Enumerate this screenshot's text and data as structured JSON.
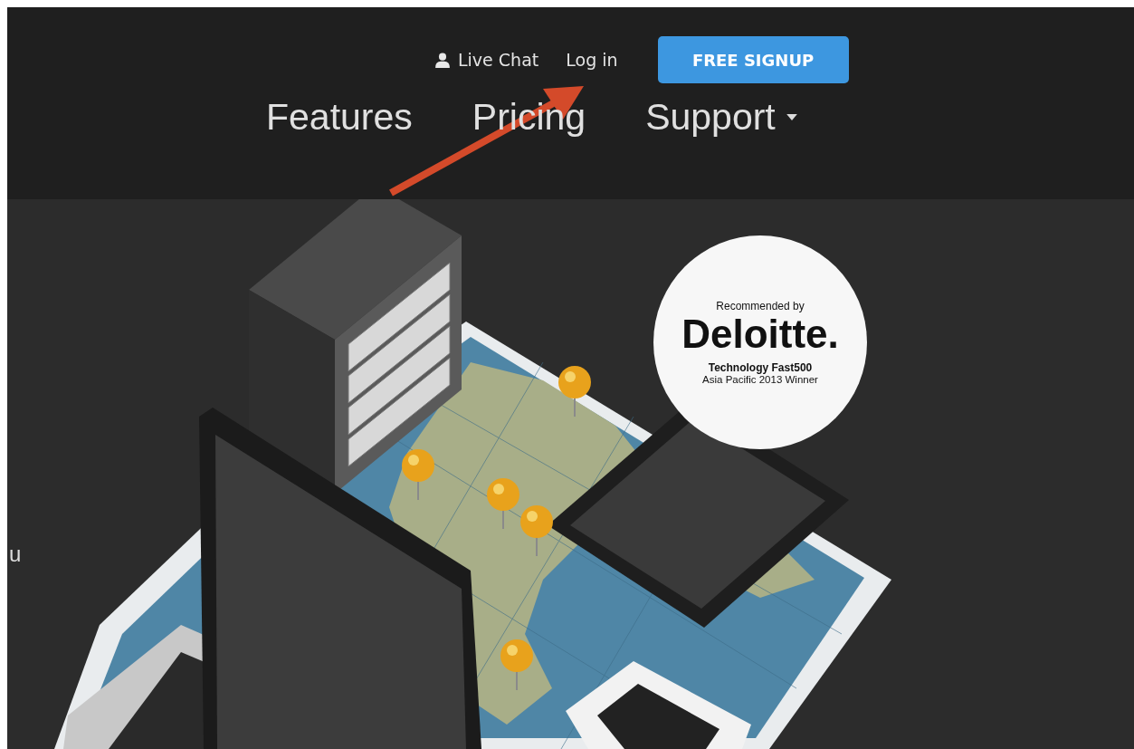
{
  "header": {
    "top_links": [
      {
        "kind": "chat",
        "label": "Live Chat"
      },
      {
        "kind": "link",
        "label": "Log in"
      }
    ],
    "signup_button": "FREE SIGNUP",
    "nav": [
      {
        "label": "Features",
        "dropdown": false
      },
      {
        "label": "Pricing",
        "dropdown": false
      },
      {
        "label": "Support",
        "dropdown": true
      }
    ]
  },
  "hero": {
    "cut_text": "u",
    "badge": {
      "line_1": "Recommended by",
      "brand": "Deloitte.",
      "line_2": "Technology Fast500",
      "line_3": "Asia Pacific 2013 Winner"
    }
  }
}
